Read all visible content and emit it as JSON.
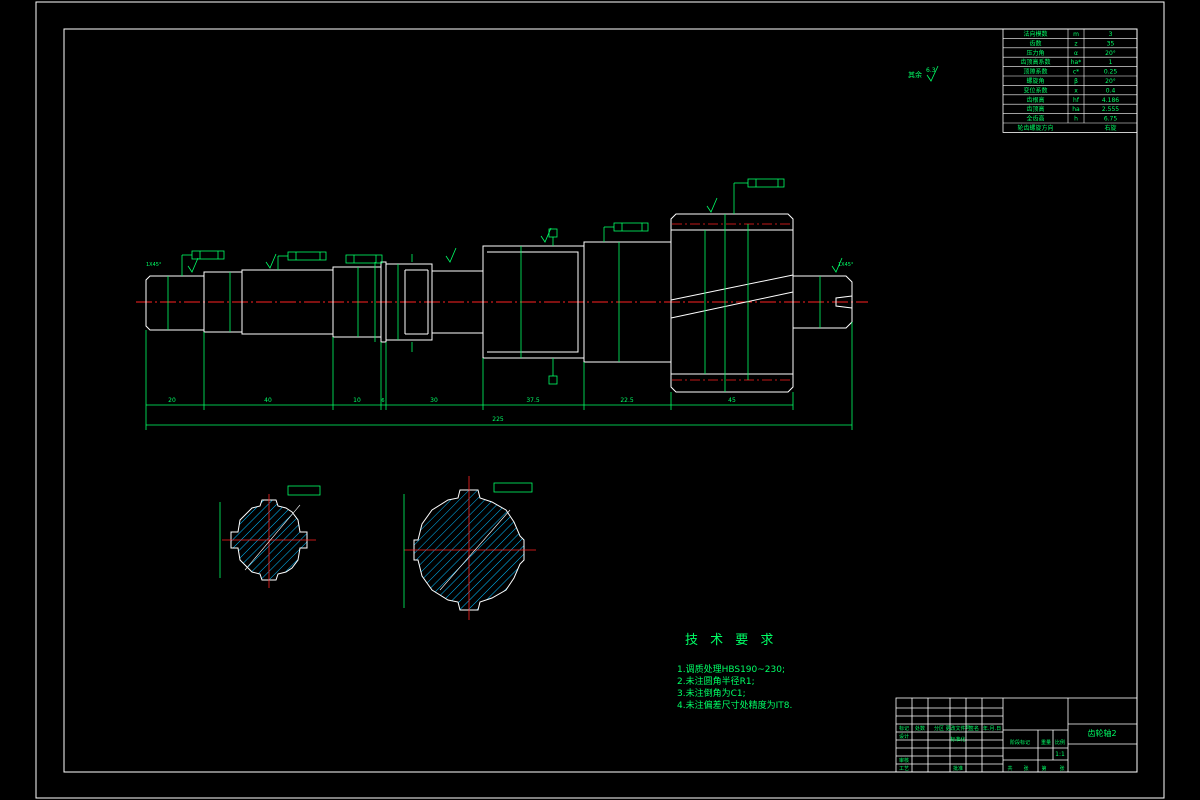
{
  "param_table": {
    "rows": [
      {
        "name": "法向模数",
        "symbol": "m",
        "value": "3"
      },
      {
        "name": "齿数",
        "symbol": "z",
        "value": "35"
      },
      {
        "name": "压力角",
        "symbol": "α",
        "value": "20°"
      },
      {
        "name": "齿顶高系数",
        "symbol": "ha*",
        "value": "1"
      },
      {
        "name": "顶隙系数",
        "symbol": "c*",
        "value": "0.25"
      },
      {
        "name": "螺旋角",
        "symbol": "β",
        "value": "20°"
      },
      {
        "name": "变位系数",
        "symbol": "x",
        "value": "0.4"
      },
      {
        "name": "齿根高",
        "symbol": "hf",
        "value": "4.186"
      },
      {
        "name": "齿顶高",
        "symbol": "ha",
        "value": "2.555"
      },
      {
        "name": "全齿高",
        "symbol": "h",
        "value": "6.75"
      },
      {
        "name": "轮齿螺旋方向",
        "symbol": "",
        "value": "右旋"
      }
    ]
  },
  "roughness_note": "其余",
  "roughness_value": "6.3",
  "dimensions": {
    "segments": [
      "20",
      "40",
      "10",
      "6",
      "30",
      "37.5",
      "22.5",
      "45"
    ],
    "total": "225",
    "chamfer_left": "1X45°",
    "chamfer_right": "1X45°"
  },
  "tech_requirements": {
    "title": "技 术 要 求",
    "items": [
      "1.调质处理HBS190~230;",
      "2.未注圆角半径R1;",
      "3.未注倒角为C1;",
      "4.未注偏差尺寸处精度为IT8."
    ]
  },
  "title_block": {
    "part_name": "齿轮轴2",
    "scale_value": "1:1",
    "labels": [
      "标记",
      "处数",
      "分区",
      "更改文件号",
      "签名",
      "年.月.日",
      "设计",
      "标准化",
      "审核",
      "工艺",
      "批准",
      "阶段标记",
      "重量",
      "比例",
      "共",
      "张",
      "第",
      "张"
    ]
  }
}
